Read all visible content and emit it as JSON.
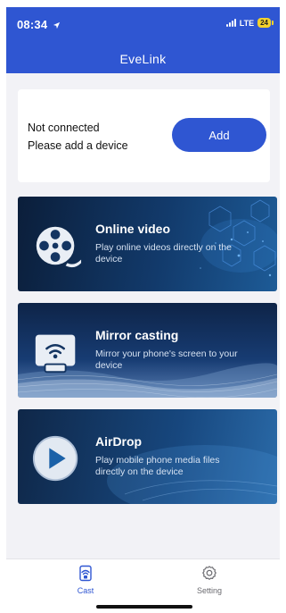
{
  "status_bar": {
    "time": "08:34",
    "network": "LTE",
    "battery": "24"
  },
  "header": {
    "title": "EveLink"
  },
  "device_card": {
    "status_line1": "Not connected",
    "status_line2": "Please add a device",
    "add_label": "Add"
  },
  "features": [
    {
      "title": "Online video",
      "description": "Play online videos directly on the device",
      "icon": "film-reel-icon"
    },
    {
      "title": "Mirror casting",
      "description": "Mirror your phone's screen to your device",
      "icon": "screen-mirror-icon"
    },
    {
      "title": "AirDrop",
      "description": "Play mobile phone media files directly on the device",
      "icon": "play-icon"
    }
  ],
  "tab_bar": {
    "items": [
      {
        "label": "Cast",
        "icon": "cast-icon",
        "active": true
      },
      {
        "label": "Setting",
        "icon": "gear-icon",
        "active": false
      }
    ]
  },
  "colors": {
    "brand": "#2f56d2",
    "background": "#f2f2f6",
    "battery": "#f4d22b"
  }
}
